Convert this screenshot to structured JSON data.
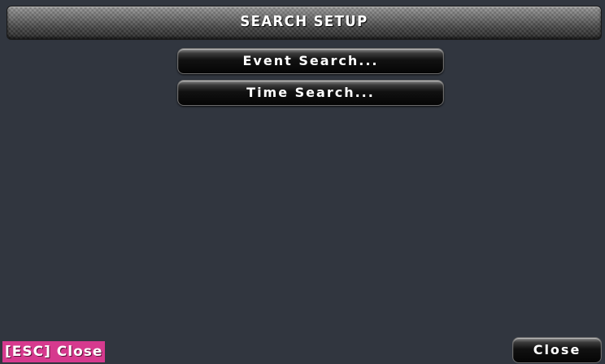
{
  "window": {
    "title": "SEARCH SETUP"
  },
  "menu": {
    "items": [
      {
        "label": "Event Search..."
      },
      {
        "label": "Time Search..."
      }
    ]
  },
  "footer": {
    "esc_hint": "[ESC] Close",
    "close_label": "Close"
  },
  "colors": {
    "background": "#31363f",
    "esc_hint_bg": "#d63a8e",
    "text": "#ffffff"
  }
}
